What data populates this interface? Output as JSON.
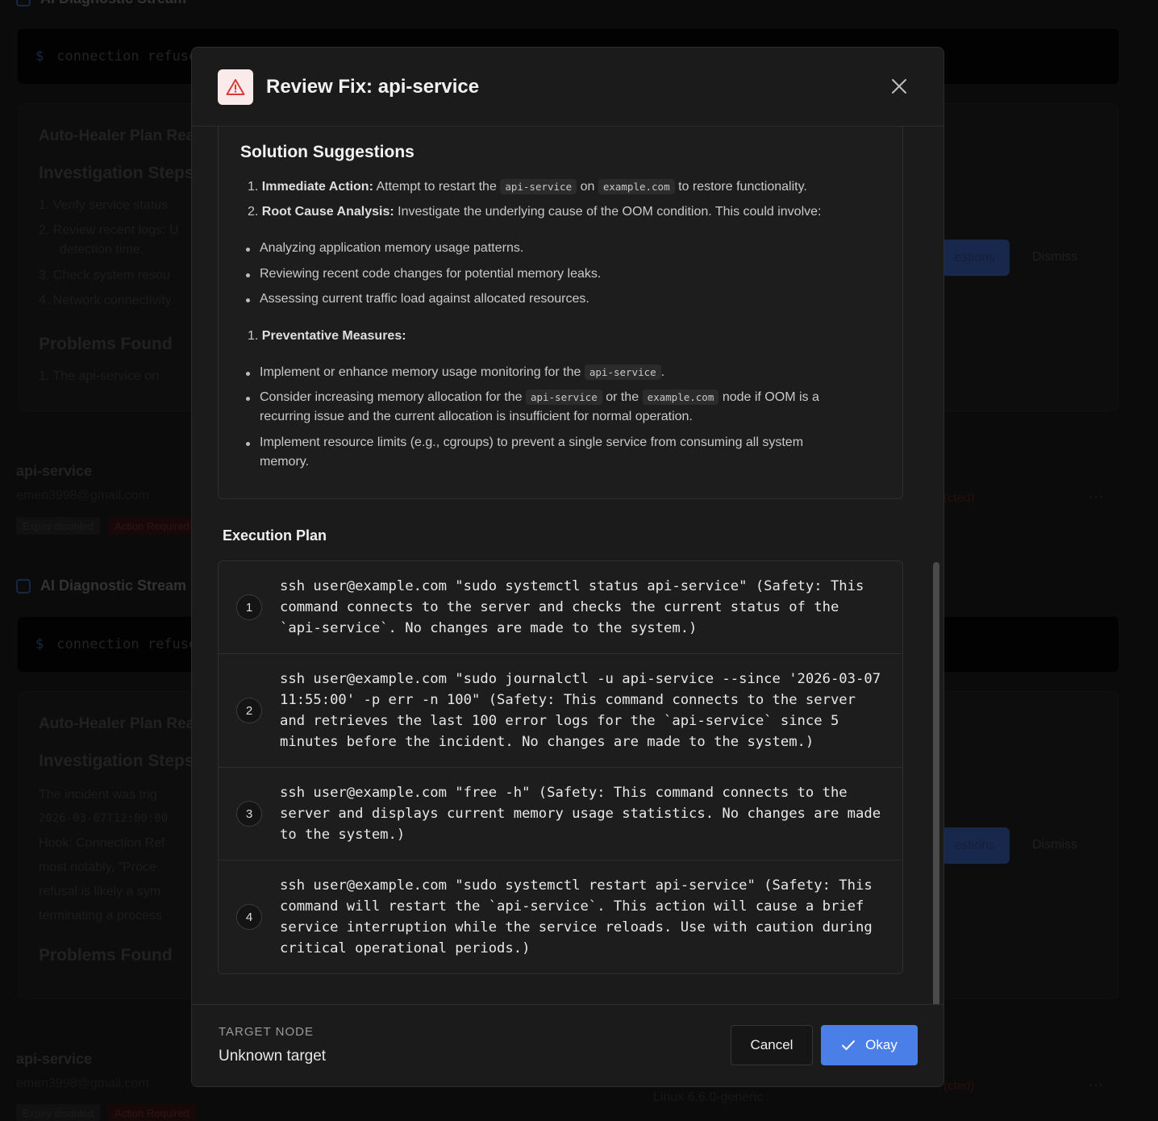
{
  "background": {
    "section_title": "AI Diagnostic Stream",
    "terminal_text": "connection refused",
    "plan_heading": "Auto-Healer Plan Ready",
    "investigation_heading": "Investigation Steps",
    "investigation_items": [
      "1. Verify service status",
      "2. Review recent logs: U",
      "detection time.",
      "3. Check system resou",
      "4. Network connectivity"
    ],
    "problems_heading": "Problems Found",
    "problems_item": "1. The api-service on",
    "suggest_label": "estions",
    "dismiss_label": "Dismiss",
    "service_name": "api-service",
    "email": "emen3998@gmail.com",
    "badge_expiry": "Expiry disabled",
    "badge_action": "Action Required",
    "status_red": "(cted)",
    "second_lines": [
      "The incident was trig",
      "2026-03-07T12:00:00",
      "Hook: Connection Ref",
      "most notably, \"Proce",
      "refusal is likely a sym",
      "terminating a process"
    ],
    "os_text": "Linux 6.6.0-generic"
  },
  "modal": {
    "title": "Review Fix: api-service",
    "solution_title": "Solution Suggestions",
    "ordered_1": {
      "num": "1.",
      "bold": "Immediate Action:",
      "pre": "Attempt to restart the",
      "code1": "api-service",
      "mid": "on",
      "code2": "example.com",
      "post": "to restore functionality."
    },
    "ordered_2": {
      "num": "2.",
      "bold": "Root Cause Analysis:",
      "text": "Investigate the underlying cause of the OOM condition. This could involve:"
    },
    "analysis_bullets": [
      "Analyzing application memory usage patterns.",
      "Reviewing recent code changes for potential memory leaks.",
      "Assessing current traffic load against allocated resources."
    ],
    "ordered_3": {
      "num": "1.",
      "bold": "Preventative Measures:"
    },
    "prevent_1": {
      "pre": "Implement or enhance memory usage monitoring for the",
      "code": "api-service",
      "post": "."
    },
    "prevent_2": {
      "pre": "Consider increasing memory allocation for the",
      "code1": "api-service",
      "mid": "or the",
      "code2": "example.com",
      "post": "node if OOM is a",
      "line2": "recurring issue and the current allocation is insufficient for normal operation."
    },
    "prevent_3": {
      "line1": "Implement resource limits (e.g., cgroups) to prevent a single service from consuming all system",
      "line2": "memory."
    },
    "execution_title": "Execution Plan",
    "steps": [
      {
        "num": "1",
        "command": "ssh user@example.com \"sudo systemctl status api-service\" (Safety: This command connects to the server and checks the current status of the `api-service`. No changes are made to the system.)"
      },
      {
        "num": "2",
        "command": "ssh user@example.com \"sudo journalctl -u api-service --since '2026-03-07 11:55:00' -p err -n 100\" (Safety: This command connects to the server and retrieves the last 100 error logs for the `api-service` since 5 minutes before the incident. No changes are made to the system.)"
      },
      {
        "num": "3",
        "command": "ssh user@example.com \"free -h\" (Safety: This command connects to the server and displays current memory usage statistics. No changes are made to the system.)"
      },
      {
        "num": "4",
        "command": "ssh user@example.com \"sudo systemctl restart api-service\" (Safety: This command will restart the `api-service`. This action will cause a brief service interruption while the service reloads. Use with caution during critical operational periods.)"
      }
    ],
    "target_node_label": "TARGET NODE",
    "target_node_value": "Unknown target",
    "cancel_label": "Cancel",
    "okay_label": "Okay"
  },
  "colors": {
    "accent": "#4a7fe8",
    "warning": "#d93a3a",
    "warning_bg": "#fbeaea",
    "modal_bg": "#1b1b1b"
  },
  "icons": {
    "modal": "warning-triangle-icon",
    "close": "close-icon",
    "okay": "check-icon"
  }
}
